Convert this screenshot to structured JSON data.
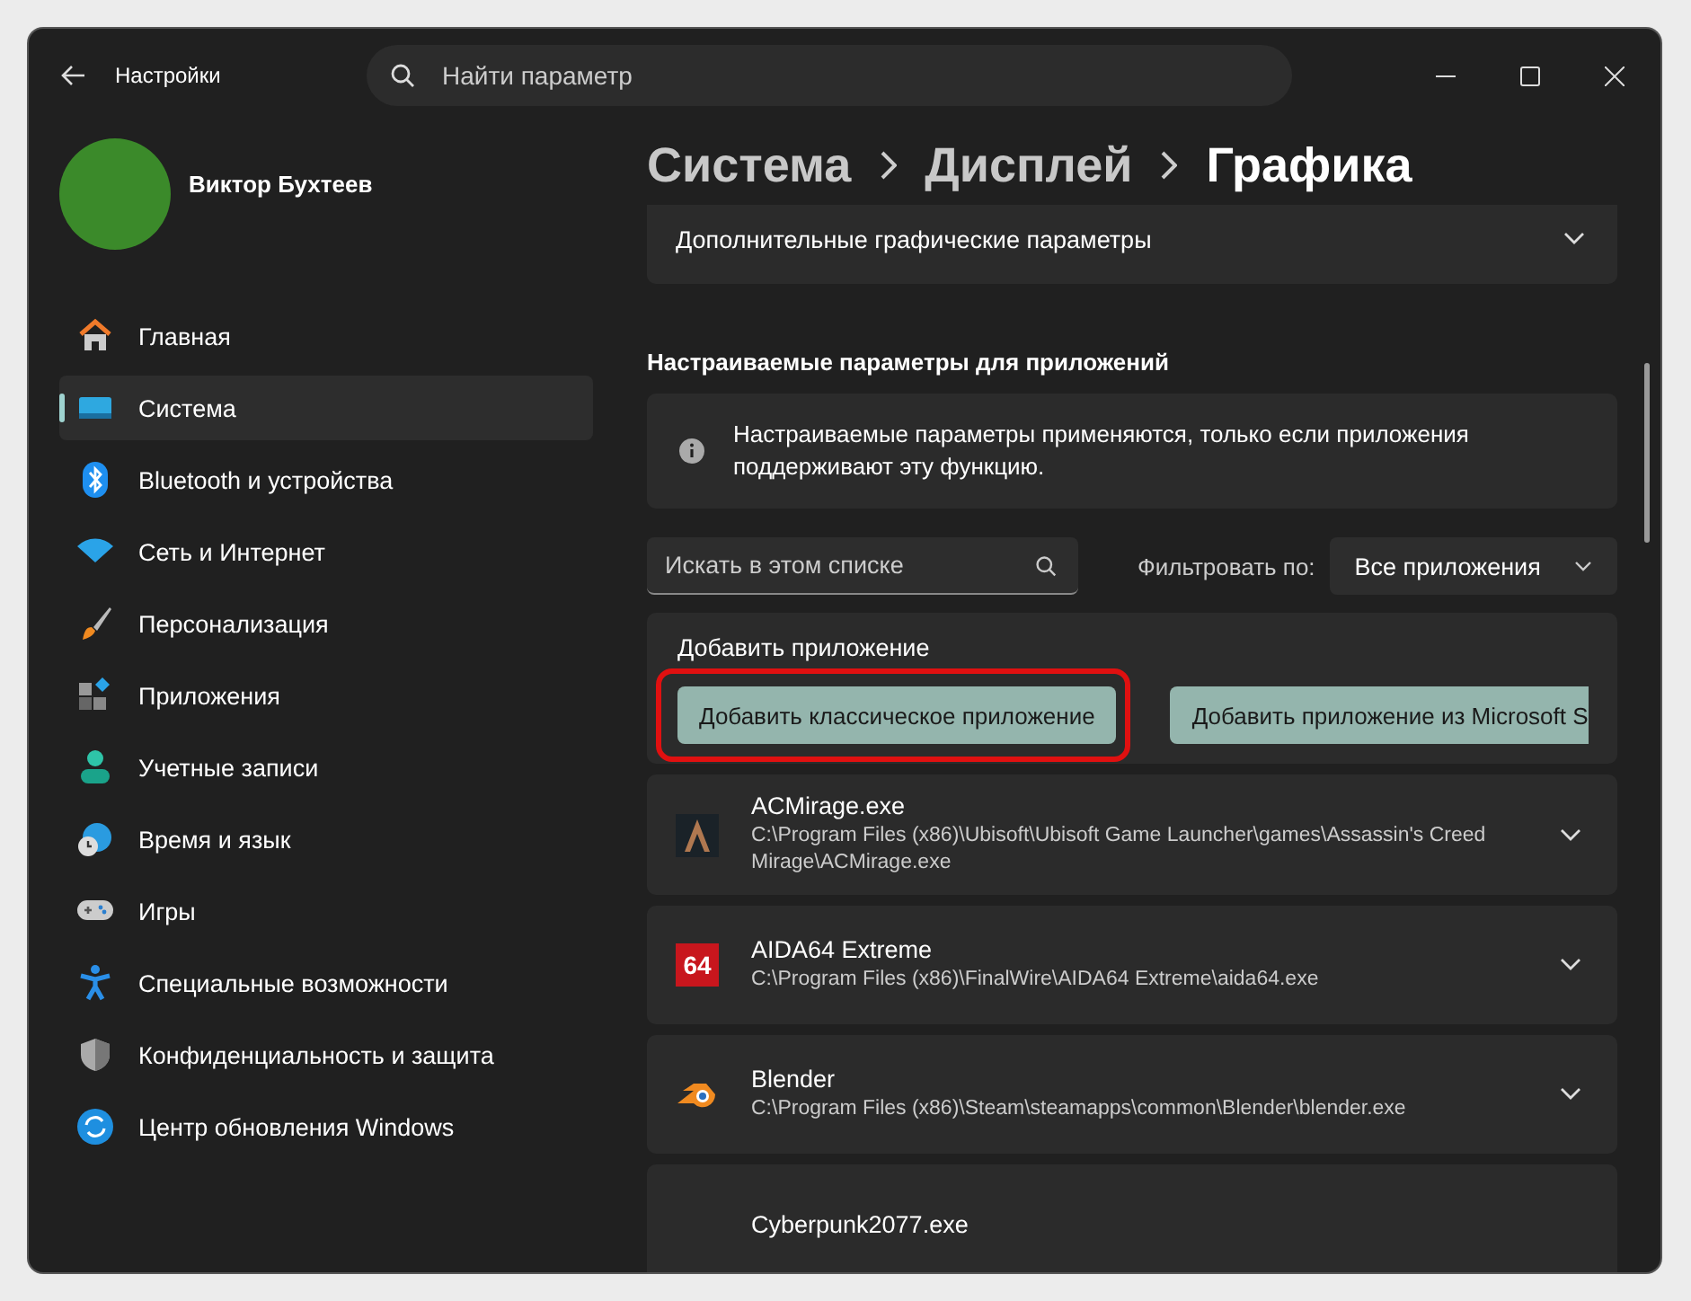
{
  "window": {
    "title": "Настройки",
    "search": {
      "placeholder": "Найти параметр"
    }
  },
  "user": {
    "name": "Виктор Бухтеев"
  },
  "sidebar": {
    "items": [
      {
        "label": "Главная",
        "kind": "home",
        "selected": false
      },
      {
        "label": "Система",
        "kind": "system",
        "selected": true
      },
      {
        "label": "Bluetooth и устройства",
        "kind": "bluetooth",
        "selected": false
      },
      {
        "label": "Сеть и Интернет",
        "kind": "wifi",
        "selected": false
      },
      {
        "label": "Персонализация",
        "kind": "brush",
        "selected": false
      },
      {
        "label": "Приложения",
        "kind": "apps",
        "selected": false
      },
      {
        "label": "Учетные записи",
        "kind": "person",
        "selected": false
      },
      {
        "label": "Время и язык",
        "kind": "time",
        "selected": false
      },
      {
        "label": "Игры",
        "kind": "gamepad",
        "selected": false
      },
      {
        "label": "Специальные возможности",
        "kind": "accessibility",
        "selected": false
      },
      {
        "label": "Конфиденциальность и защита",
        "kind": "shield",
        "selected": false
      },
      {
        "label": "Центр обновления Windows",
        "kind": "update",
        "selected": false
      }
    ]
  },
  "breadcrumb": [
    "Система",
    "Дисплей",
    "Графика"
  ],
  "advanced": {
    "label": "Дополнительные графические параметры"
  },
  "section_title": "Настраиваемые параметры для приложений",
  "info": "Настраиваемые параметры применяются, только если приложения поддерживают эту функцию.",
  "list_search": {
    "placeholder": "Искать в этом списке"
  },
  "filter": {
    "label": "Фильтровать по:",
    "value": "Все приложения"
  },
  "add": {
    "title": "Добавить приложение",
    "buttons": [
      {
        "label": "Добавить классическое приложение",
        "highlighted": true
      },
      {
        "label": "Добавить приложение из Microsoft S",
        "highlighted": false
      }
    ]
  },
  "apps": [
    {
      "name": "ACMirage.exe",
      "path": "C:\\Program Files (x86)\\Ubisoft\\Ubisoft Game Launcher\\games\\Assassin's Creed Mirage\\ACMirage.exe",
      "kind": "acm"
    },
    {
      "name": "AIDA64 Extreme",
      "path": "C:\\Program Files (x86)\\FinalWire\\AIDA64 Extreme\\aida64.exe",
      "kind": "aida",
      "logo_text": "64"
    },
    {
      "name": "Blender",
      "path": "C:\\Program Files (x86)\\Steam\\steamapps\\common\\Blender\\blender.exe",
      "kind": "blender"
    },
    {
      "name": "Cyberpunk2077.exe",
      "kind": "none"
    }
  ]
}
